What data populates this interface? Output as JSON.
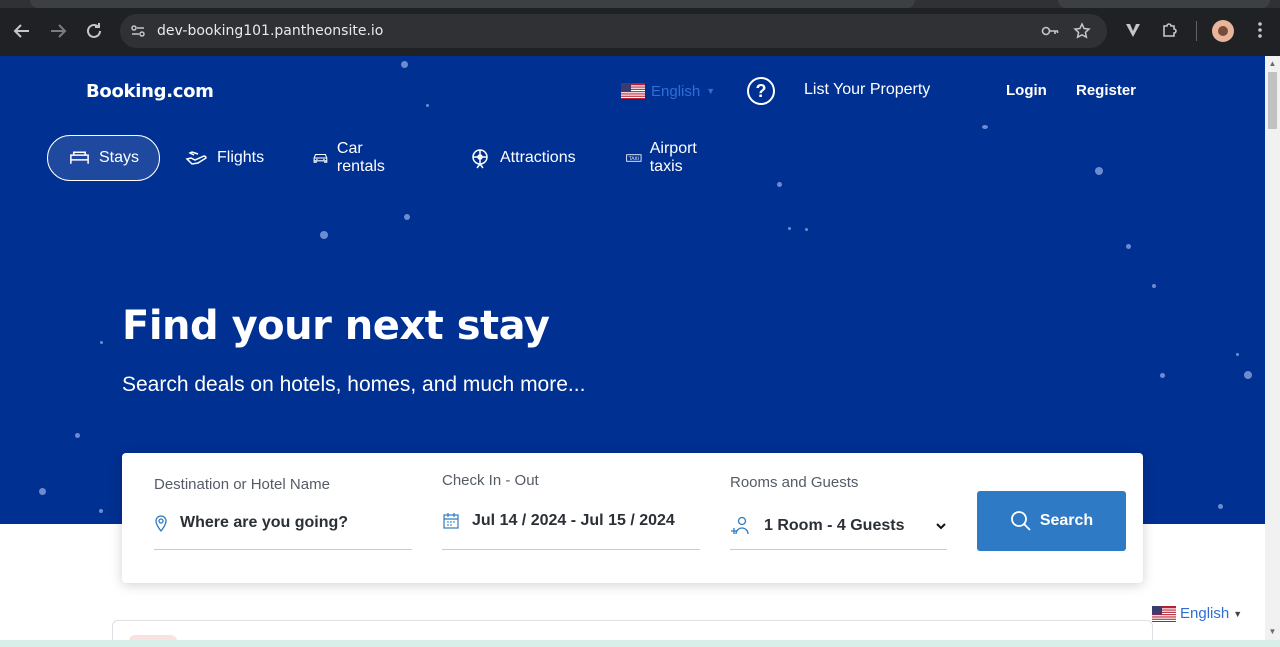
{
  "browser": {
    "url": "dev-booking101.pantheonsite.io",
    "icons": [
      "back-icon",
      "forward-icon",
      "reload-icon",
      "site-settings-icon",
      "password-key-icon",
      "bookmark-star-icon",
      "extension-v-icon",
      "extensions-puzzle-icon",
      "profile-avatar",
      "more-menu-icon"
    ]
  },
  "header": {
    "brand": "Booking.com",
    "language": "English",
    "list_property": "List Your Property",
    "login": "Login",
    "register": "Register"
  },
  "nav": {
    "tabs": [
      {
        "label": "Stays",
        "icon": "bed-icon",
        "active": true
      },
      {
        "label": "Flights",
        "icon": "plane-icon",
        "active": false
      },
      {
        "label": "Car rentals",
        "icon": "car-icon",
        "active": false
      },
      {
        "label": "Attractions",
        "icon": "attractions-icon",
        "active": false
      },
      {
        "label": "Airport taxis",
        "icon": "taxi-icon",
        "active": false
      }
    ]
  },
  "hero": {
    "title": "Find your next stay",
    "subtitle": "Search deals on hotels, homes, and much more..."
  },
  "search": {
    "destination_label": "Destination or Hotel Name",
    "destination_placeholder": "Where are you going?",
    "dates_label": "Check In - Out",
    "dates_value": "Jul 14 / 2024 - Jul 15 / 2024",
    "rooms_label": "Rooms and Guests",
    "rooms_value": "1 Room - 4 Guests",
    "button_label": "Search"
  },
  "footer_language": "English",
  "colors": {
    "hero_bg": "#003092",
    "search_button": "#2f7ac4",
    "language_link": "#2f6fd4"
  }
}
